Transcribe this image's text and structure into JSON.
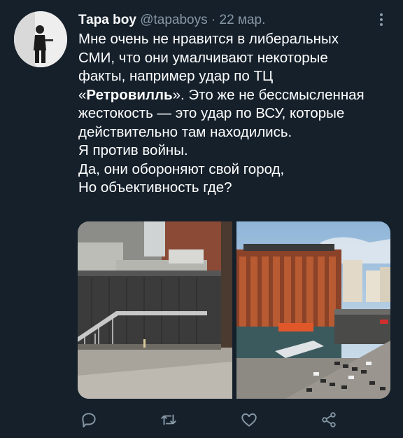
{
  "tweet": {
    "author_name": "Тара boy",
    "handle": "@tapaboys",
    "separator": "·",
    "date": "22 мар.",
    "lines": [
      {
        "pre": "Мне очень не нравится в либеральных",
        "bold": "",
        "post": ""
      },
      {
        "pre": "СМИ, что они умалчивают некоторые",
        "bold": "",
        "post": ""
      },
      {
        "pre": "факты, например удар по ТЦ",
        "bold": "",
        "post": ""
      },
      {
        "pre": "«",
        "bold": "Ретровилль",
        "post": "». Это же не бессмысленная"
      },
      {
        "pre": "жестокость — это удар по ВСУ, которые",
        "bold": "",
        "post": ""
      },
      {
        "pre": "действительно там находились.",
        "bold": "",
        "post": ""
      },
      {
        "pre": "Я против войны.",
        "bold": "",
        "post": ""
      },
      {
        "pre": "Да, они обороняют свой город,",
        "bold": "",
        "post": ""
      },
      {
        "pre": "Но объективность где?",
        "bold": "",
        "post": ""
      }
    ]
  },
  "media": {
    "photos": [
      "photo-building-back",
      "photo-mall-front"
    ]
  },
  "actions": [
    {
      "name": "reply-icon"
    },
    {
      "name": "retweet-icon"
    },
    {
      "name": "like-icon"
    },
    {
      "name": "share-icon"
    }
  ],
  "colors": {
    "background": "#15202b",
    "text": "#ffffff",
    "secondary": "#8899a6"
  }
}
